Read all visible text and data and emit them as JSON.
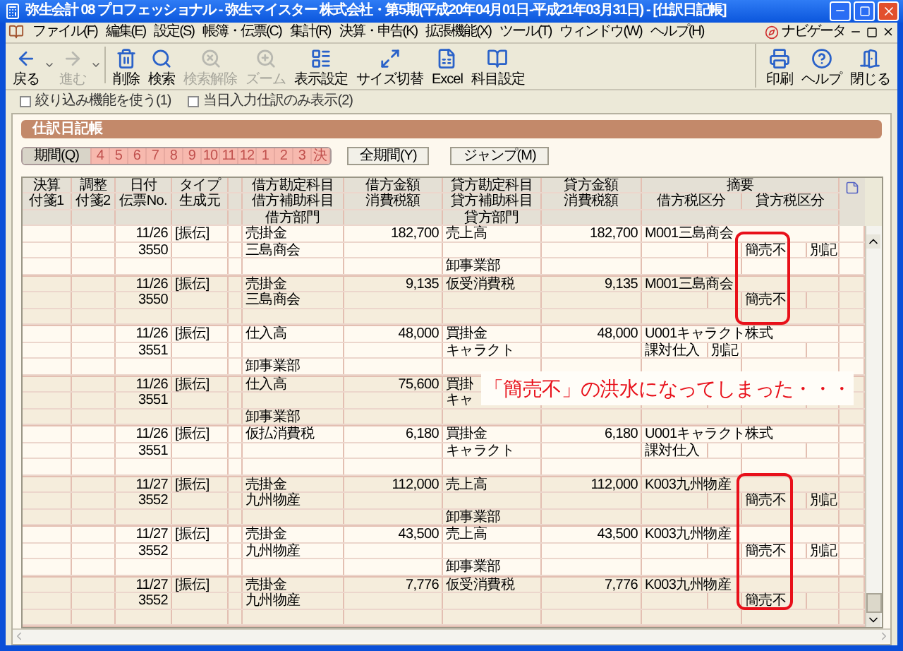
{
  "window": {
    "title": "弥生会計 08 プロフェッショナル - 弥生マイスター 株式会社・第5期(平成20年04月01日-平成21年03月31日) - [仕訳日記帳]"
  },
  "menu": [
    "ファイル(F)",
    "編集(E)",
    "設定(S)",
    "帳簿・伝票(C)",
    "集計(R)",
    "決算・申告(K)",
    "拡張機能(X)",
    "ツール(T)",
    "ウィンドウ(W)",
    "ヘルプ(H)"
  ],
  "navigator": "ナビゲータ",
  "toolbar": [
    {
      "label": "戻る",
      "disabled": false
    },
    {
      "label": "進む",
      "disabled": true
    },
    {
      "label": "削除",
      "disabled": false
    },
    {
      "label": "検索",
      "disabled": false
    },
    {
      "label": "検索解除",
      "disabled": true
    },
    {
      "label": "ズーム",
      "disabled": true
    },
    {
      "label": "表示設定",
      "disabled": false
    },
    {
      "label": "サイズ切替",
      "disabled": false
    },
    {
      "label": "Excel",
      "disabled": false
    },
    {
      "label": "科目設定",
      "disabled": false
    }
  ],
  "toolbar_right": [
    {
      "label": "印刷",
      "disabled": false
    },
    {
      "label": "ヘルプ",
      "disabled": false
    },
    {
      "label": "閉じる",
      "disabled": false
    }
  ],
  "options": [
    {
      "label": "絞り込み機能を使う(1)",
      "checked": false
    },
    {
      "label": "当日入力仕訳のみ表示(2)",
      "checked": false
    }
  ],
  "section_title": "仕訳日記帳",
  "period_tabs": [
    {
      "label": "期間(Q)",
      "selected": true
    },
    {
      "label": "4",
      "selected": false
    },
    {
      "label": "5",
      "selected": false
    },
    {
      "label": "6",
      "selected": false
    },
    {
      "label": "7",
      "selected": false
    },
    {
      "label": "8",
      "selected": false
    },
    {
      "label": "9",
      "selected": false
    },
    {
      "label": "10",
      "selected": false
    },
    {
      "label": "11",
      "selected": false
    },
    {
      "label": "12",
      "selected": false
    },
    {
      "label": "1",
      "selected": false
    },
    {
      "label": "2",
      "selected": false
    },
    {
      "label": "3",
      "selected": false
    },
    {
      "label": "決",
      "selected": false
    }
  ],
  "buttons": [
    "全期間(Y)",
    "ジャンプ(M)"
  ],
  "table": {
    "header": [
      [
        "決算",
        "調整",
        "日付",
        "タイプ",
        "借方勘定科目",
        "借方金額",
        "貸方勘定科目",
        "貸方金額",
        "摘要"
      ],
      [
        "付箋1",
        "付箋2",
        "伝票No.",
        "生成元",
        "借方補助科目",
        "消費税額",
        "貸方補助科目",
        "消費税額",
        "借方税区分",
        "貸方税区分"
      ],
      [
        "借方部門",
        "貸方部門"
      ]
    ],
    "rows": [
      {
        "date": "11/26",
        "type": "[振伝]",
        "voucher": "3550",
        "debit_account": "売掛金",
        "debit_sub": "三島商会",
        "debit_amount": "182,700",
        "credit_account": "売上高",
        "credit_dept": "卸事業部",
        "credit_amount": "182,700",
        "memo": "M001三島商会",
        "credit_tax": [
          "簡売不",
          "別記"
        ]
      },
      {
        "date": "11/26",
        "type": "[振伝]",
        "voucher": "3550",
        "debit_account": "売掛金",
        "debit_sub": "三島商会",
        "debit_amount": "9,135",
        "credit_account": "仮受消費税",
        "credit_amount": "9,135",
        "memo": "M001三島商会",
        "credit_tax": [
          "簡売不"
        ]
      },
      {
        "date": "11/26",
        "type": "[振伝]",
        "voucher": "3551",
        "debit_account": "仕入高",
        "debit_dept": "卸事業部",
        "debit_amount": "48,000",
        "credit_account": "買掛金",
        "credit_sub": "キャラクト",
        "credit_amount": "48,000",
        "memo": "U001キャラクト株式",
        "debit_tax": [
          "課対仕入",
          "別記"
        ]
      },
      {
        "date": "11/26",
        "type": "[振伝]",
        "voucher": "3551",
        "debit_account": "仕入高",
        "debit_dept": "卸事業部",
        "debit_amount": "75,600",
        "credit_account": "買掛",
        "credit_sub": "キャ"
      },
      {
        "date": "11/26",
        "type": "[振伝]",
        "voucher": "3551",
        "debit_account": "仮払消費税",
        "debit_amount": "6,180",
        "credit_account": "買掛金",
        "credit_sub": "キャラクト",
        "credit_amount": "6,180",
        "memo": "U001キャラクト株式",
        "debit_tax": [
          "課対仕入"
        ]
      },
      {
        "date": "11/27",
        "type": "[振伝]",
        "voucher": "3552",
        "debit_account": "売掛金",
        "debit_sub": "九州物産",
        "debit_amount": "112,000",
        "credit_account": "売上高",
        "credit_dept": "卸事業部",
        "credit_amount": "112,000",
        "memo": "K003九州物産",
        "credit_tax": [
          "簡売不",
          "別記"
        ]
      },
      {
        "date": "11/27",
        "type": "[振伝]",
        "voucher": "3552",
        "debit_account": "売掛金",
        "debit_sub": "九州物産",
        "debit_amount": "43,500",
        "credit_account": "売上高",
        "credit_dept": "卸事業部",
        "credit_amount": "43,500",
        "memo": "K003九州物産",
        "credit_tax": [
          "簡売不",
          "別記"
        ]
      },
      {
        "date": "11/27",
        "type": "[振伝]",
        "voucher": "3552",
        "debit_account": "売掛金",
        "debit_sub": "九州物産",
        "debit_amount": "7,776",
        "credit_account": "仮受消費税",
        "credit_amount": "7,776",
        "memo": "K003九州物産",
        "credit_tax": [
          "簡売不"
        ]
      }
    ]
  },
  "annotation": {
    "text": "「簡売不」の洪水になってしまった・・・"
  }
}
